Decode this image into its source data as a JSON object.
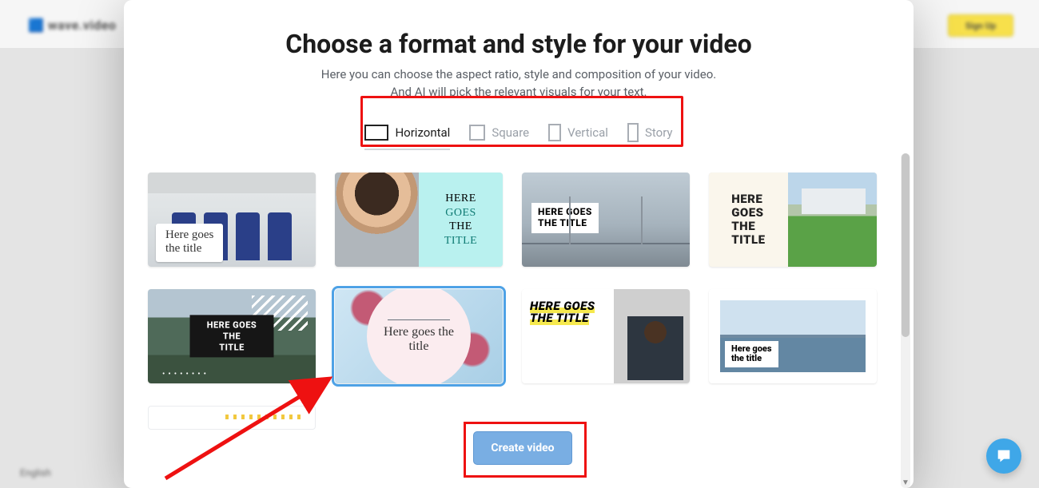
{
  "backdrop": {
    "logo": "wave.video",
    "signup": "Sign Up",
    "language": "English"
  },
  "modal": {
    "title": "Choose a format and style for your video",
    "subtitle1": "Here you can choose the aspect ratio, style and composition of your video.",
    "subtitle2": "And AI will pick the relevant visuals for your text.",
    "formats": [
      {
        "id": "horizontal",
        "label": "Horizontal",
        "active": true
      },
      {
        "id": "square",
        "label": "Square",
        "active": false
      },
      {
        "id": "vertical",
        "label": "Vertical",
        "active": false
      },
      {
        "id": "story",
        "label": "Story",
        "active": false
      }
    ],
    "cta": "Create video",
    "selected_template_index": 5
  },
  "templates": [
    {
      "id": "kitchen",
      "title_line1": "Here goes",
      "title_line2": "the title"
    },
    {
      "id": "portrait",
      "title_lines": [
        "HERE",
        "GOES",
        "THE",
        "TITLE"
      ]
    },
    {
      "id": "bridge",
      "title_line1": "HERE GOES",
      "title_line2": "THE TITLE"
    },
    {
      "id": "house",
      "title_lines": [
        "HERE",
        "GOES",
        "THE",
        "TITLE"
      ]
    },
    {
      "id": "mountain",
      "title_line1": "HERE GOES THE",
      "title_line2": "TITLE"
    },
    {
      "id": "blossom",
      "title_line1": "Here goes the",
      "title_line2": "title"
    },
    {
      "id": "studio",
      "title_line1": "HERE GOES",
      "title_line2": "THE TITLE"
    },
    {
      "id": "sea",
      "title_line1": "Here goes",
      "title_line2": "the title"
    }
  ],
  "annotations": {
    "highlight_formats": true,
    "highlight_cta": true,
    "arrow_to_selected": true
  }
}
